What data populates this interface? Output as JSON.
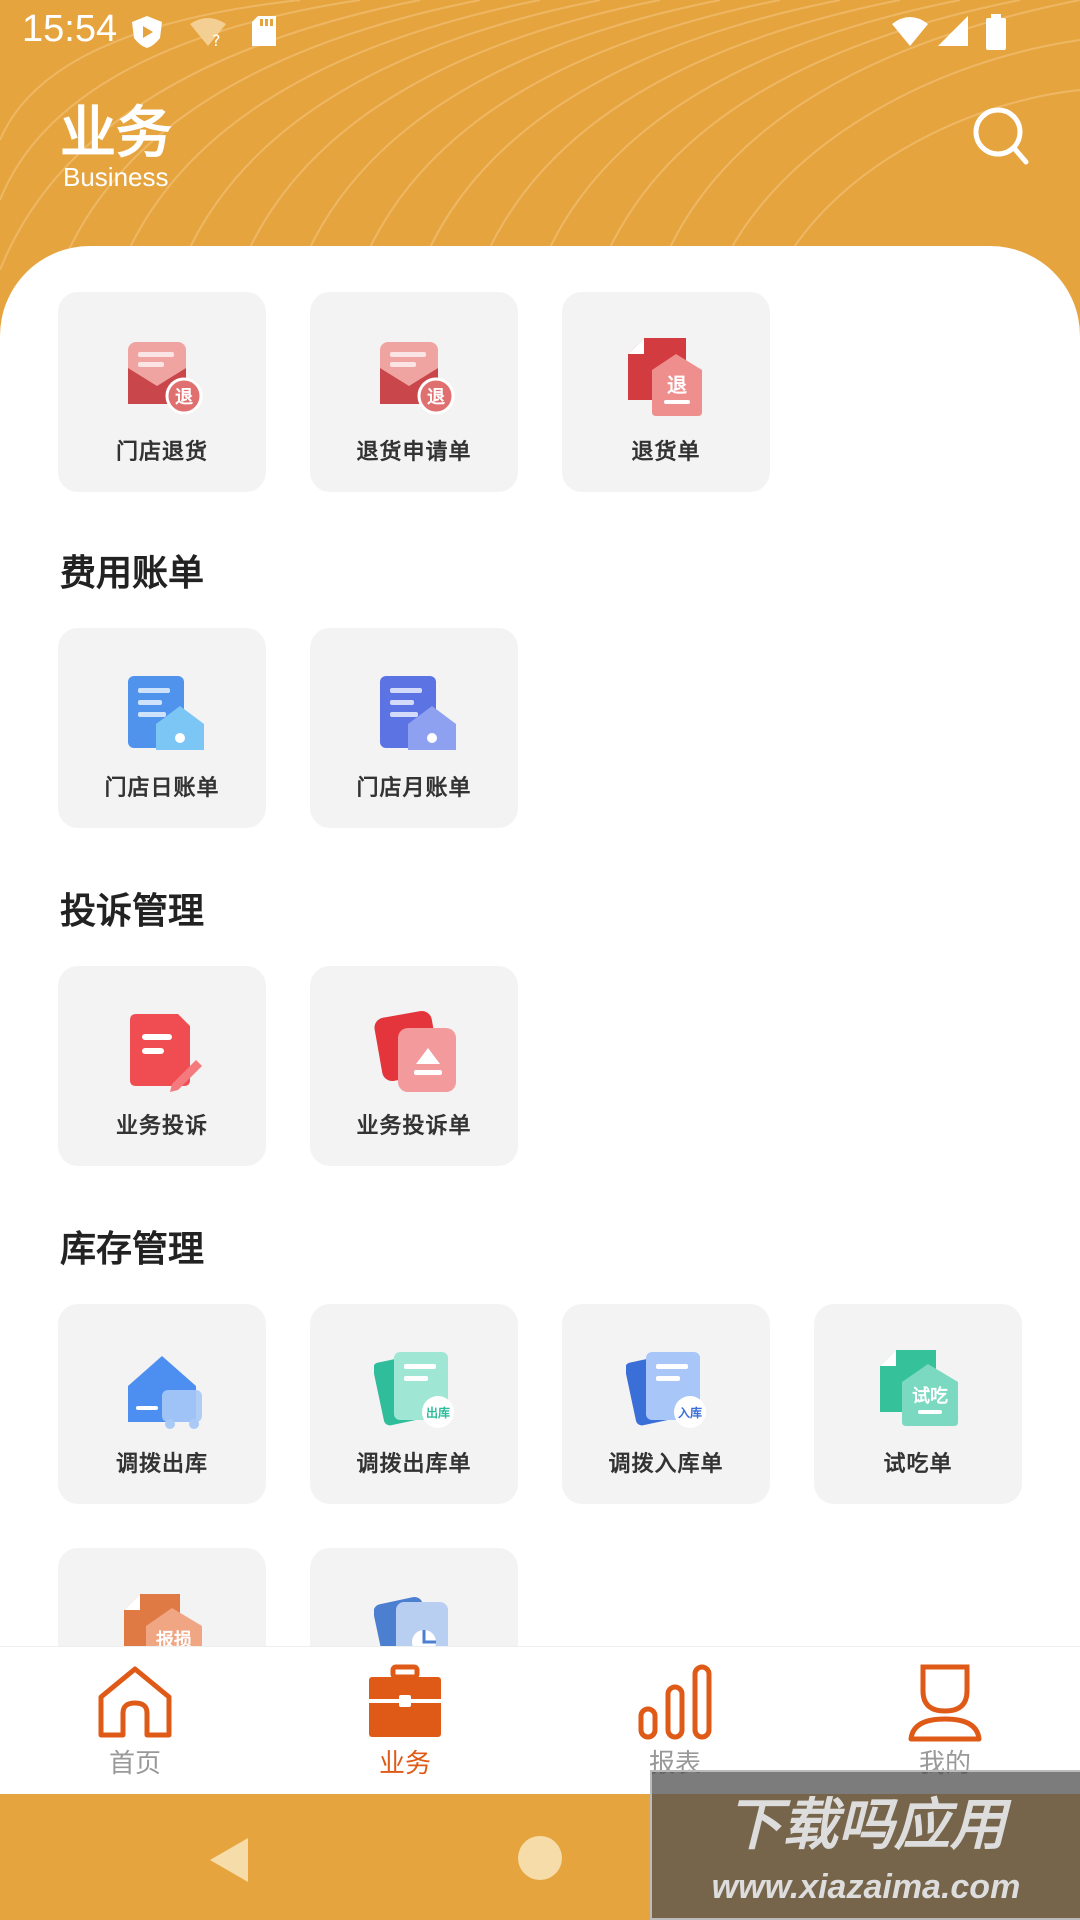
{
  "status_bar": {
    "time": "15:54"
  },
  "header": {
    "title": "业务",
    "subtitle": "Business"
  },
  "sections": [
    {
      "title": "",
      "items": [
        {
          "label": "门店退货",
          "icon": "store-return-icon"
        },
        {
          "label": "退货申请单",
          "icon": "return-request-icon"
        },
        {
          "label": "退货单",
          "icon": "return-order-icon"
        }
      ]
    },
    {
      "title": "费用账单",
      "items": [
        {
          "label": "门店日账单",
          "icon": "daily-bill-icon"
        },
        {
          "label": "门店月账单",
          "icon": "monthly-bill-icon"
        }
      ]
    },
    {
      "title": "投诉管理",
      "items": [
        {
          "label": "业务投诉",
          "icon": "complaint-icon"
        },
        {
          "label": "业务投诉单",
          "icon": "complaint-form-icon"
        }
      ]
    },
    {
      "title": "库存管理",
      "items": [
        {
          "label": "调拨出库",
          "icon": "transfer-out-icon"
        },
        {
          "label": "调拨出库单",
          "icon": "transfer-out-form-icon"
        },
        {
          "label": "调拨入库单",
          "icon": "transfer-in-form-icon"
        },
        {
          "label": "试吃单",
          "icon": "tasting-form-icon"
        },
        {
          "label": "",
          "icon": "loss-report-icon"
        },
        {
          "label": "",
          "icon": "inventory-report-icon"
        }
      ]
    }
  ],
  "icon_badges": {
    "return": "退",
    "out": "出库",
    "in": "入库",
    "tasting": "试吃",
    "loss": "报损"
  },
  "tabbar": [
    {
      "label": "首页",
      "icon": "home-icon",
      "active": false
    },
    {
      "label": "业务",
      "icon": "briefcase-icon",
      "active": true
    },
    {
      "label": "报表",
      "icon": "bar-chart-icon",
      "active": false
    },
    {
      "label": "我的",
      "icon": "person-icon",
      "active": false
    }
  ],
  "watermark": {
    "line1": "下载吗应用",
    "line2": "www.xiazaima.com"
  },
  "colors": {
    "accent": "#e6a43f",
    "tab_active": "#e05a17",
    "tile_bg": "#f3f3f3"
  }
}
